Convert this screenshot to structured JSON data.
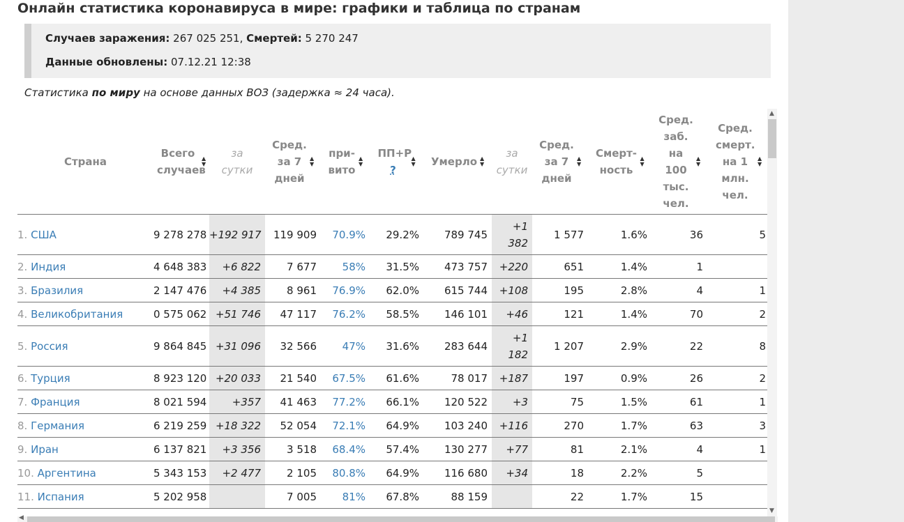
{
  "title": "Онлайн статистика коронавируса в мире: графики и таблица по странам",
  "summary": {
    "cases_label": "Случаев заражения:",
    "cases_value": "267 025 251,",
    "deaths_label": "Смертей:",
    "deaths_value": "5 270 247",
    "updated_label": "Данные обновлены:",
    "updated_value": "07.12.21 12:38"
  },
  "note": {
    "part1": "Статистика ",
    "bold": "по миру",
    "part2": " на основе данных ВОЗ (задержка ≈ 24 часа)."
  },
  "headers": {
    "country": "Страна",
    "total_cases": "Всего случаев",
    "cases_day": "за сутки",
    "avg7": "Сред. за 7 дней",
    "vaccinated": "при-вито",
    "ppr": "ПП+Р",
    "ppr_q": "?",
    "deaths": "Умерло",
    "deaths_day": "за сутки",
    "avg7_deaths": "Сред. за 7 дней",
    "mortality": "Смерт-ность",
    "avg_cases_100k": "Сред. заб. на 100 тыс. чел.",
    "avg_deaths_1m": "Сред. смерт. на 1 млн. чел."
  },
  "sort_icon": "▲▼",
  "rows": [
    {
      "num": "1.",
      "name": "США",
      "total": "9 278 278",
      "day": "+192 917",
      "avg7": "119 909",
      "vac": "70.9%",
      "ppr": "29.2%",
      "deaths": "789 745",
      "dday": "+1 382",
      "davg": "1 577",
      "mort": "1.6%",
      "c100k": "36",
      "d1m": "5"
    },
    {
      "num": "2.",
      "name": "Индия",
      "total": "4 648 383",
      "day": "+6 822",
      "avg7": "7 677",
      "vac": "58%",
      "ppr": "31.5%",
      "deaths": "473 757",
      "dday": "+220",
      "davg": "651",
      "mort": "1.4%",
      "c100k": "1",
      "d1m": ""
    },
    {
      "num": "3.",
      "name": "Бразилия",
      "total": "2 147 476",
      "day": "+4 385",
      "avg7": "8 961",
      "vac": "76.9%",
      "ppr": "62.0%",
      "deaths": "615 744",
      "dday": "+108",
      "davg": "195",
      "mort": "2.8%",
      "c100k": "4",
      "d1m": "1"
    },
    {
      "num": "4.",
      "name": "Великобритания",
      "total": "0 575 062",
      "day": "+51 746",
      "avg7": "47 117",
      "vac": "76.2%",
      "ppr": "58.5%",
      "deaths": "146 101",
      "dday": "+46",
      "davg": "121",
      "mort": "1.4%",
      "c100k": "70",
      "d1m": "2"
    },
    {
      "num": "5.",
      "name": "Россия",
      "total": "9 864 845",
      "day": "+31 096",
      "avg7": "32 566",
      "vac": "47%",
      "ppr": "31.6%",
      "deaths": "283 644",
      "dday": "+1 182",
      "davg": "1 207",
      "mort": "2.9%",
      "c100k": "22",
      "d1m": "8"
    },
    {
      "num": "6.",
      "name": "Турция",
      "total": "8 923 120",
      "day": "+20 033",
      "avg7": "21 540",
      "vac": "67.5%",
      "ppr": "61.6%",
      "deaths": "78 017",
      "dday": "+187",
      "davg": "197",
      "mort": "0.9%",
      "c100k": "26",
      "d1m": "2"
    },
    {
      "num": "7.",
      "name": "Франция",
      "total": "8 021 594",
      "day": "+357",
      "avg7": "41 463",
      "vac": "77.2%",
      "ppr": "66.1%",
      "deaths": "120 522",
      "dday": "+3",
      "davg": "75",
      "mort": "1.5%",
      "c100k": "61",
      "d1m": "1"
    },
    {
      "num": "8.",
      "name": "Германия",
      "total": "6 219 259",
      "day": "+18 322",
      "avg7": "52 054",
      "vac": "72.1%",
      "ppr": "64.9%",
      "deaths": "103 240",
      "dday": "+116",
      "davg": "270",
      "mort": "1.7%",
      "c100k": "63",
      "d1m": "3"
    },
    {
      "num": "9.",
      "name": "Иран",
      "total": "6 137 821",
      "day": "+3 356",
      "avg7": "3 518",
      "vac": "68.4%",
      "ppr": "57.4%",
      "deaths": "130 277",
      "dday": "+77",
      "davg": "81",
      "mort": "2.1%",
      "c100k": "4",
      "d1m": "1"
    },
    {
      "num": "10.",
      "name": "Аргентина",
      "total": "5 343 153",
      "day": "+2 477",
      "avg7": "2 105",
      "vac": "80.8%",
      "ppr": "64.9%",
      "deaths": "116 680",
      "dday": "+34",
      "davg": "18",
      "mort": "2.2%",
      "c100k": "5",
      "d1m": ""
    },
    {
      "num": "11.",
      "name": "Испания",
      "total": "5 202 958",
      "day": "",
      "avg7": "7 005",
      "vac": "81%",
      "ppr": "67.8%",
      "deaths": "88 159",
      "dday": "",
      "davg": "22",
      "mort": "1.7%",
      "c100k": "15",
      "d1m": ""
    }
  ]
}
